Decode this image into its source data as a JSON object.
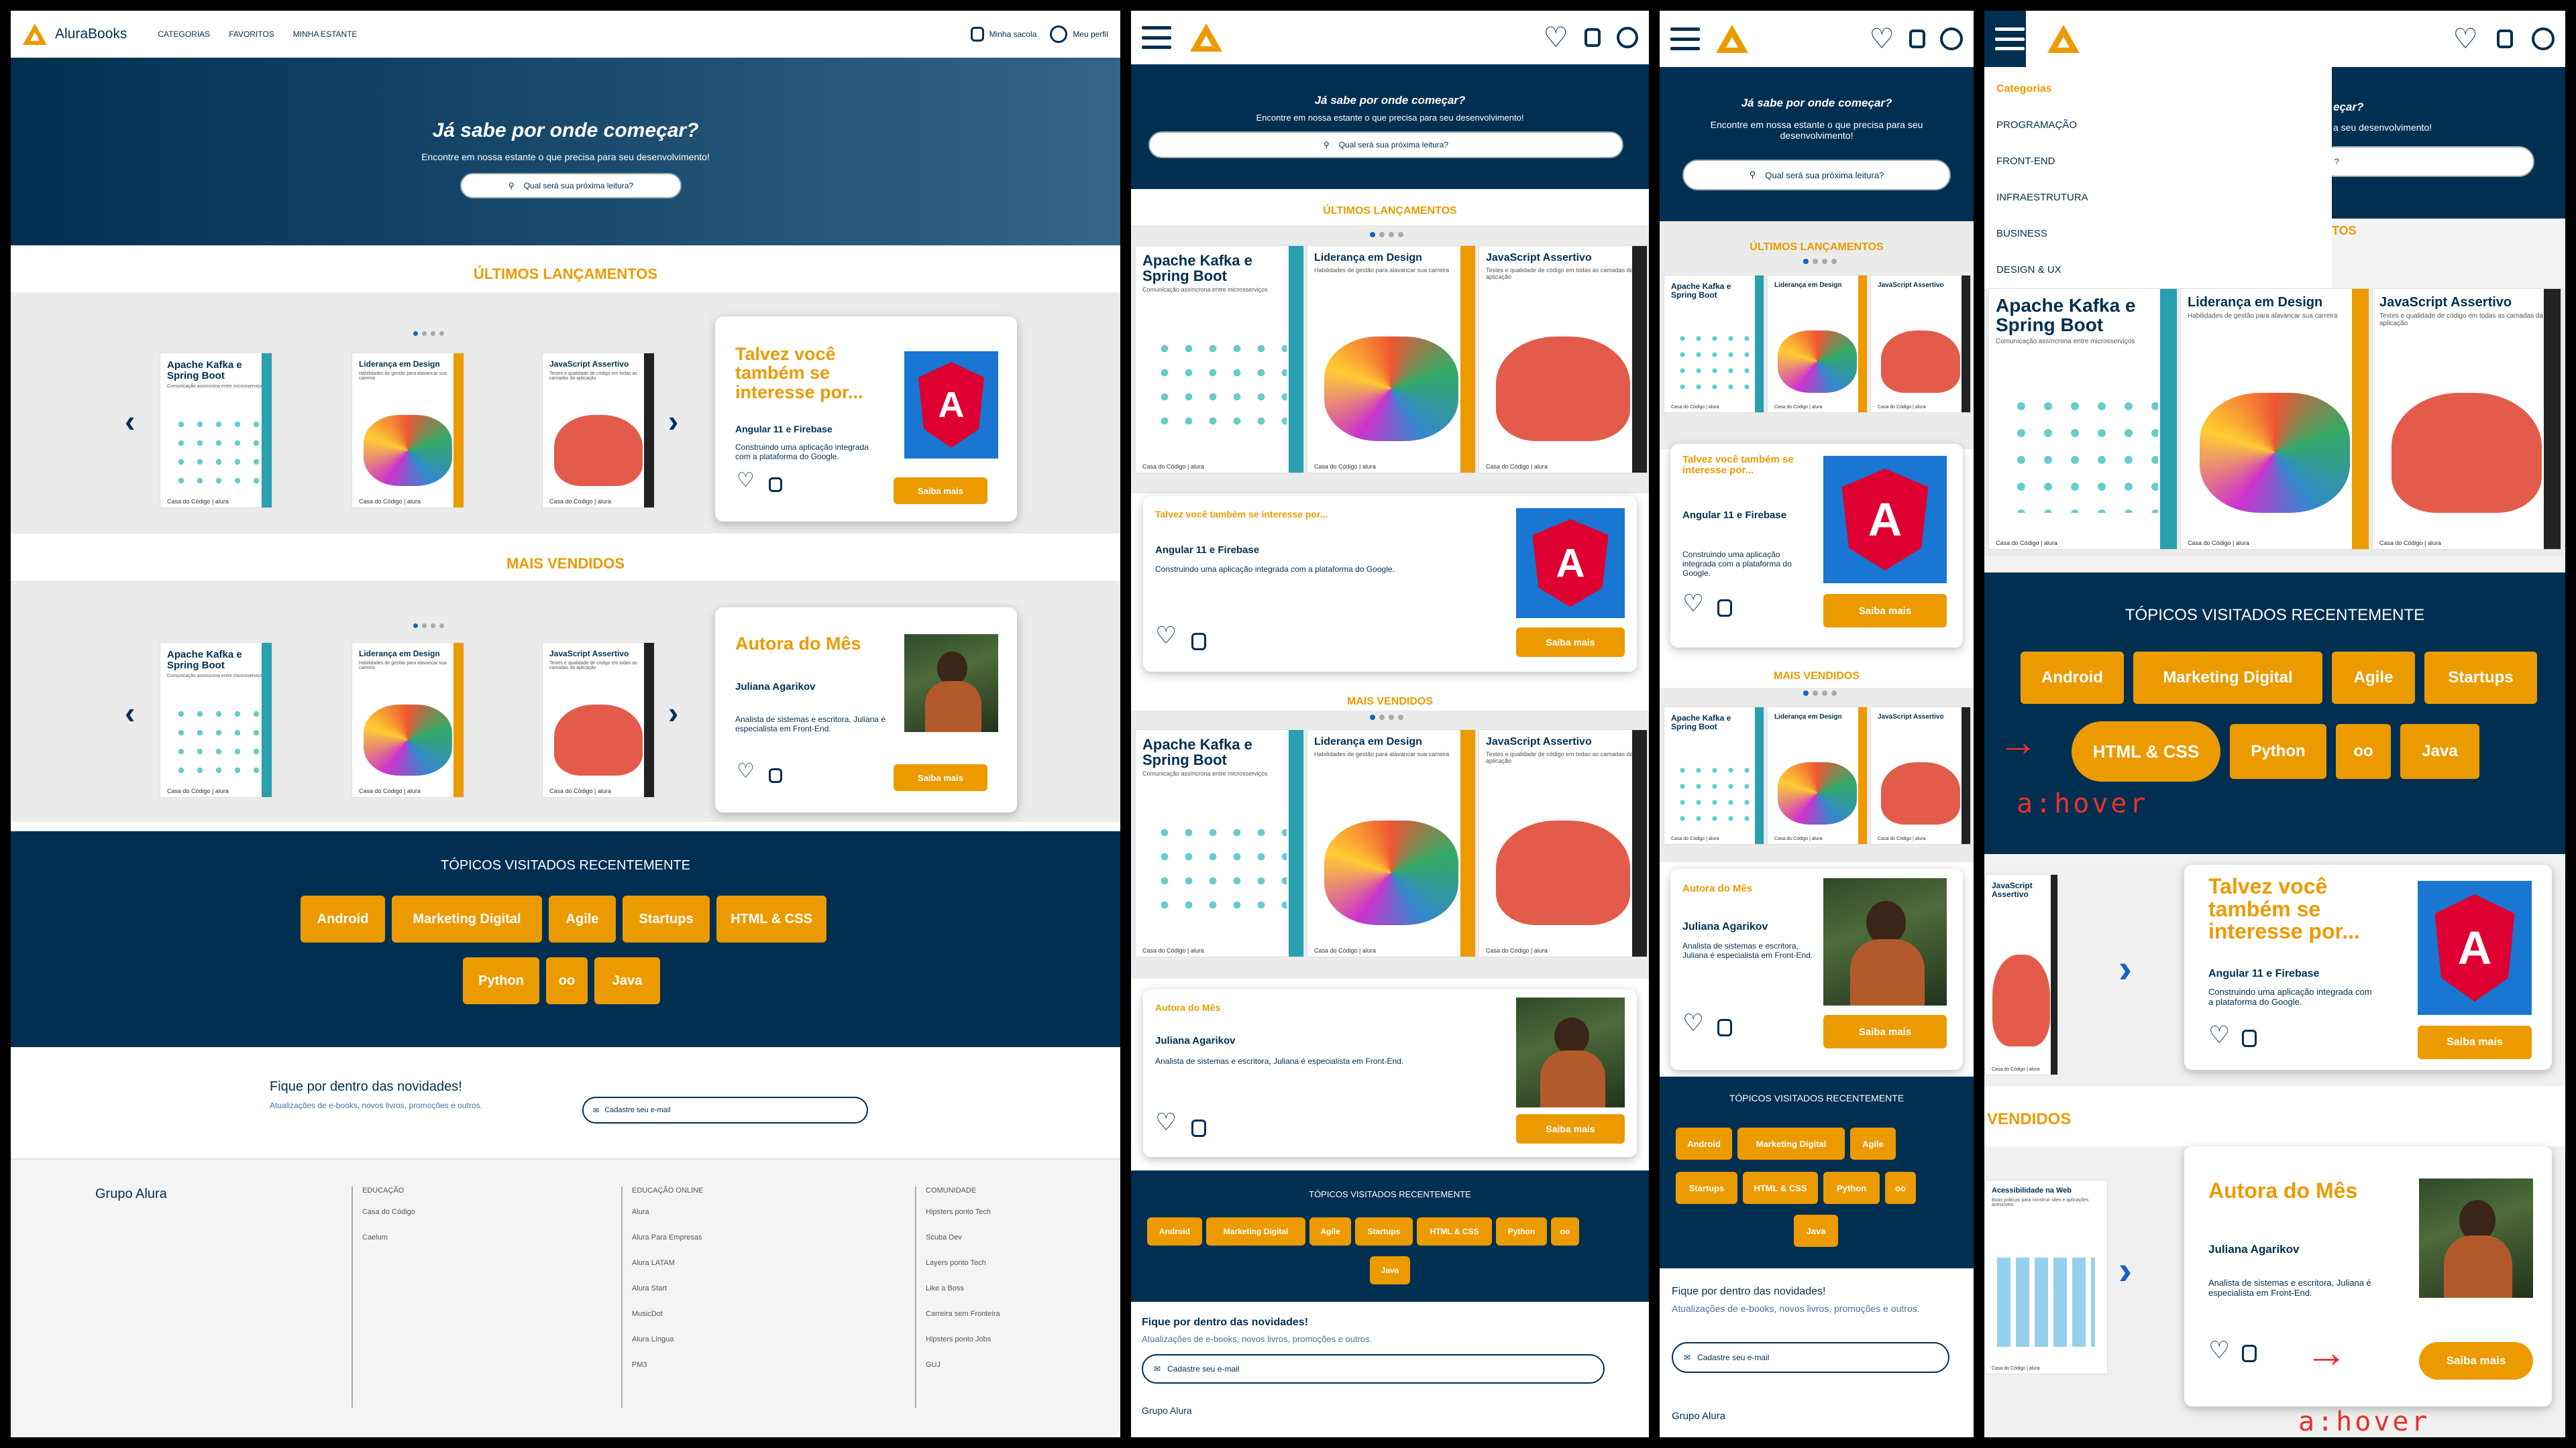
{
  "brand": {
    "name": "AluraBooks",
    "accent": "#eb9b00",
    "navy": "#002f52"
  },
  "nav": {
    "categories": "CATEGORIAS",
    "favorites": "FAVORITOS",
    "shelf": "MINHA ESTANTE",
    "bag": "Minha sacola",
    "profile": "Meu perfil"
  },
  "hero": {
    "title": "Já sabe por onde começar?",
    "subtitle": "Encontre em nossa estante o que precisa para seu desenvolvimento!",
    "search_placeholder": "Qual será sua próxima leitura?"
  },
  "sections": {
    "latest": "ÚLTIMOS LANÇAMENTOS",
    "bestsellers": "MAIS VENDIDOS",
    "bestsellers_cut": "VENDIDOS",
    "latest_cut": "TOS"
  },
  "books": [
    {
      "title": "Apache Kafka e Spring Boot",
      "subtitle": "Comunicação assíncrona entre microsserviços",
      "color": "#2a9fb0",
      "publisher": "Casa do Código | alura"
    },
    {
      "title": "Liderança em Design",
      "subtitle": "Habilidades de gestão para alavancar sua carreira",
      "color": "#eb9b00",
      "publisher": "Casa do Código | alura"
    },
    {
      "title": "JavaScript Assertivo",
      "subtitle": "Testes e qualidade de código em todas as camadas da aplicação",
      "color": "#222222",
      "publisher": "Casa do Código | alura"
    },
    {
      "title": "Acessibilidade na Web",
      "subtitle": "Boas práticas para construir sites e aplicações acessíveis",
      "color": "#2a9fb0",
      "publisher": "Casa do Código | alura"
    }
  ],
  "suggest": {
    "title": "Talvez você também se interesse por...",
    "book": "Angular 11 e Firebase",
    "desc": "Construindo uma aplicação integrada com a plataforma do Google.",
    "button": "Saiba mais",
    "logo_letter": "A"
  },
  "author": {
    "title": "Autora do Mês",
    "name": "Juliana Agarikov",
    "desc": "Analista de sistemas e escritora, Juliana é especialista em Front-End.",
    "button": "Saiba mais"
  },
  "topics": {
    "title": "TÓPICOS VISITADOS RECENTEMENTE",
    "items": [
      "Android",
      "Marketing Digital",
      "Agile",
      "Startups",
      "HTML & CSS",
      "Python",
      "oo",
      "Java"
    ]
  },
  "newsletter": {
    "title": "Fique por dentro das novidades!",
    "subtitle": "Atualizações de e-books, novos livros, promoções e outros.",
    "placeholder": "Cadastre seu e-mail"
  },
  "footer": {
    "brand": "Grupo Alura",
    "col1": {
      "title": "EDUCAÇÃO",
      "items": [
        "Casa do Código",
        "Caelum"
      ]
    },
    "col2": {
      "title": "EDUCAÇÃO ONLINE",
      "items": [
        "Alura",
        "Alura Para Empresas",
        "Alura LATAM",
        "Alura Start",
        "MusicDot",
        "Alura Língua",
        "PM3"
      ]
    },
    "col3": {
      "title": "COMUNIDADE",
      "items": [
        "Hipsters ponto Tech",
        "Scuba Dev",
        "Layers ponto Tech",
        "Like a Boss",
        "Carreira sem Fronteira",
        "Hipsters ponto Jobs",
        "GUJ"
      ]
    }
  },
  "menu": {
    "title": "Categorias",
    "items": [
      "PROGRAMAÇÃO",
      "FRONT-END",
      "INFRAESTRUTURA",
      "BUSINESS",
      "DESIGN & UX"
    ]
  },
  "hover_label": "a:hover",
  "hero_cut": {
    "l1": "eçar?",
    "l2": "a seu desenvolvimento!",
    "l3": "?"
  }
}
